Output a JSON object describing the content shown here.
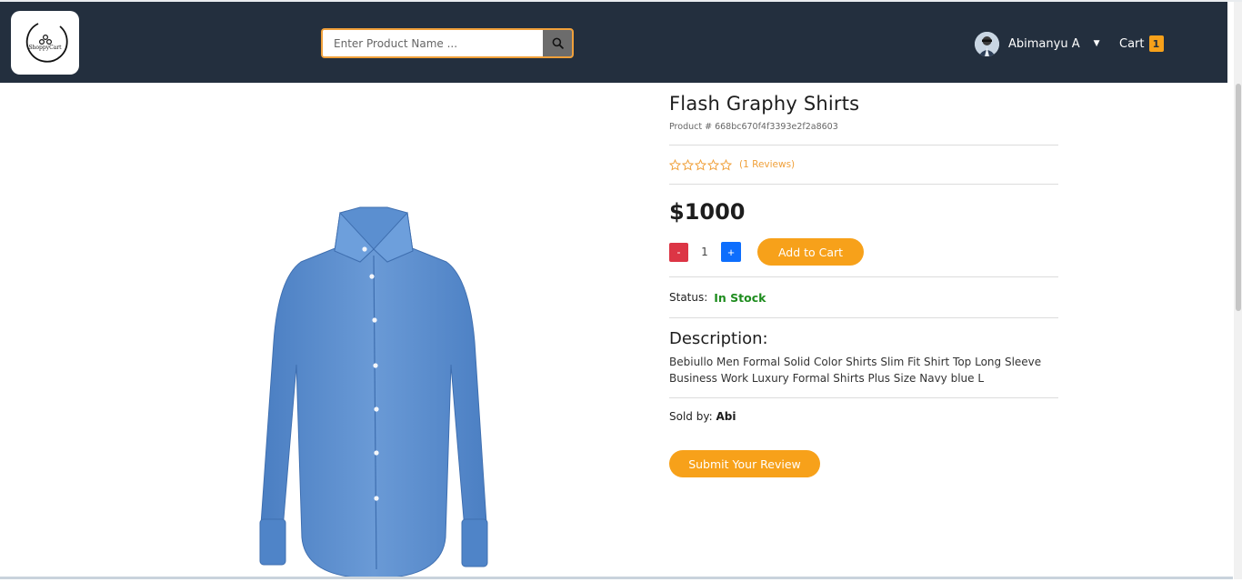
{
  "header": {
    "logo_text": "ShoppyCart",
    "search": {
      "placeholder": "Enter Product Name ...",
      "value": ""
    },
    "user": {
      "name": "Abimanyu A"
    },
    "cart": {
      "label": "Cart",
      "count": "1"
    }
  },
  "product": {
    "title": "Flash Graphy Shirts",
    "product_id": "Product # 668bc670f4f3393e2f2a8603",
    "rating": {
      "stars": 0,
      "max": 5,
      "reviews_text": "(1 Reviews)"
    },
    "price": "$1000",
    "quantity": "1",
    "minus_label": "-",
    "plus_label": "+",
    "add_to_cart_label": "Add to Cart",
    "status_label": "Status:",
    "status_value": "In Stock",
    "description_title": "Description:",
    "description": "Bebiullo Men Formal Solid Color Shirts Slim Fit Shirt Top Long Sleeve Business Work Luxury Formal Shirts Plus Size Navy blue L",
    "sold_by_label": "Sold by:",
    "seller": "Abi",
    "review_button_label": "Submit Your Review"
  },
  "colors": {
    "navbar": "#232f3e",
    "accent": "#f7a11a",
    "in_stock": "#1e8c1e",
    "minus": "#dc3545",
    "plus": "#0d6efd",
    "shirt": "#5b8fd0"
  }
}
